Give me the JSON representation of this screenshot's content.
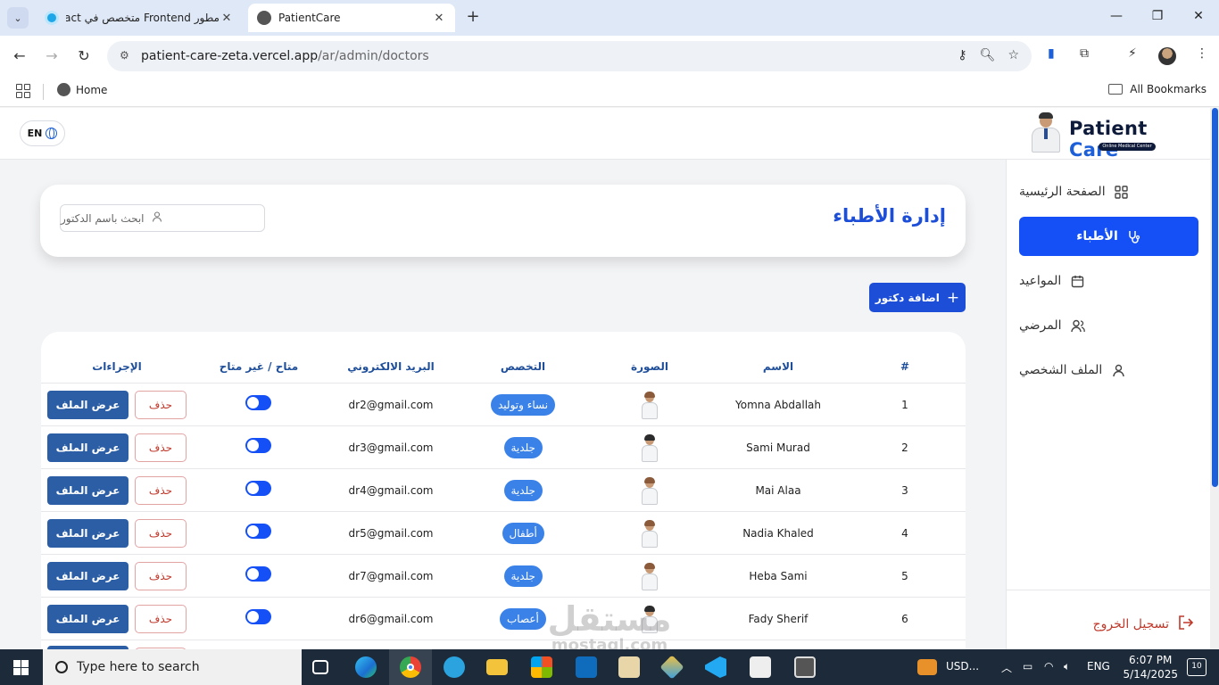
{
  "browser": {
    "tabs": [
      {
        "title": "مطور Frontend متخصص في React",
        "active": false
      },
      {
        "title": "PatientCare",
        "active": true
      }
    ],
    "url_host": "patient-care-zeta.vercel.app",
    "url_path": "/ar/admin/doctors",
    "bookmarks": {
      "home": "Home",
      "all": "All Bookmarks"
    }
  },
  "app": {
    "lang_button": "EN",
    "logo": {
      "word1": "Patient",
      "word2": "Care",
      "tagline": "Online Medical Center"
    },
    "sidebar": {
      "items": [
        {
          "label": "الصفحة الرئيسية",
          "icon": "dashboard-grid-icon",
          "active": false
        },
        {
          "label": "الأطباء",
          "icon": "stethoscope-icon",
          "active": true
        },
        {
          "label": "المواعيد",
          "icon": "calendar-icon",
          "active": false
        },
        {
          "label": "المرضي",
          "icon": "users-icon",
          "active": false
        },
        {
          "label": "الملف الشخصي",
          "icon": "user-icon",
          "active": false
        }
      ],
      "logout": "تسجيل الخروج"
    },
    "page_title": "إدارة الأطباء",
    "search_placeholder": "ابحث باسم الدكتور",
    "add_button": "اضافة دكتور",
    "table": {
      "headers": {
        "num": "#",
        "name": "الاسم",
        "photo": "الصورة",
        "specialty": "التخصص",
        "email": "البريد الالكتروني",
        "availability": "متاح / غير متاح",
        "actions": "الإجراءات"
      },
      "rows": [
        {
          "num": "1",
          "name": "Yomna Abdallah",
          "specialty": "نساء وتوليد",
          "email": "dr2@gmail.com",
          "available": true,
          "gender": "f"
        },
        {
          "num": "2",
          "name": "Sami Murad",
          "specialty": "جلدية",
          "email": "dr3@gmail.com",
          "available": true,
          "gender": "m"
        },
        {
          "num": "3",
          "name": "Mai Alaa",
          "specialty": "جلدية",
          "email": "dr4@gmail.com",
          "available": true,
          "gender": "f"
        },
        {
          "num": "4",
          "name": "Nadia Khaled",
          "specialty": "أطفال",
          "email": "dr5@gmail.com",
          "available": true,
          "gender": "f"
        },
        {
          "num": "5",
          "name": "Heba Sami",
          "specialty": "جلدية",
          "email": "dr7@gmail.com",
          "available": true,
          "gender": "f"
        },
        {
          "num": "6",
          "name": "Fady Sherif",
          "specialty": "أعصاب",
          "email": "dr6@gmail.com",
          "available": true,
          "gender": "m"
        }
      ],
      "delete_label": "حذف",
      "view_label": "عرض الملف"
    },
    "colors": {
      "primary": "#1450f5",
      "title": "#1d4ed8",
      "view_button": "#2b5ea5",
      "danger": "#c0392b",
      "badge": "#3b82e8"
    }
  },
  "watermark": {
    "arabic": "مستقل",
    "latin": "mostaql.com"
  },
  "taskbar": {
    "search_placeholder": "Type here to search",
    "tray_currency": "USD...",
    "lang": "ENG",
    "time": "6:07 PM",
    "date": "5/14/2025",
    "notifications": "10"
  }
}
